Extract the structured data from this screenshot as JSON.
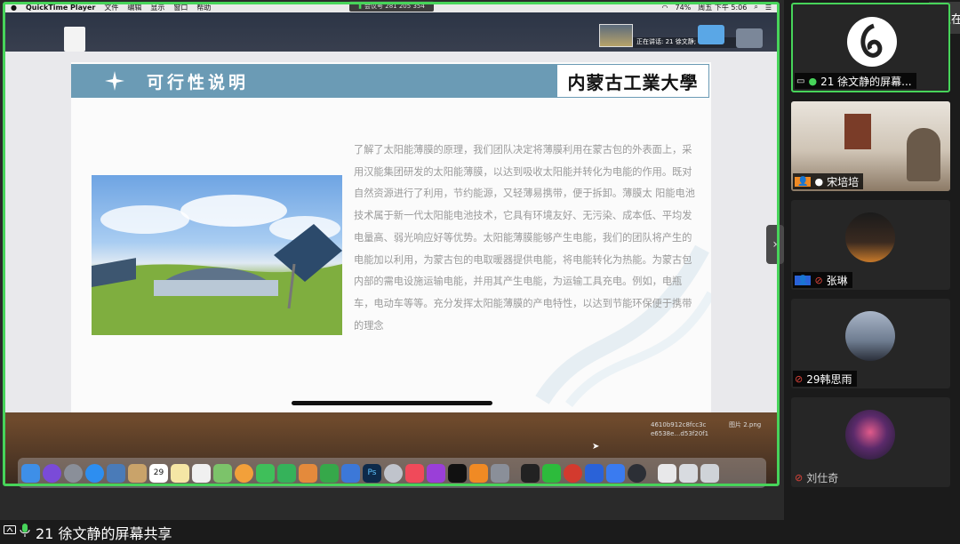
{
  "menubar": {
    "app_name": "QuickTime Player",
    "items": [
      "文件",
      "编辑",
      "显示",
      "窗口",
      "帮助"
    ],
    "meeting_id": "会议号 281 205 354",
    "battery": "74%",
    "clock": "周五 下午 5:06"
  },
  "desktop": {
    "speaking_label": "正在讲话: 21 徐文静;",
    "hash_line1": "4610b912c8fcc3c",
    "hash_line2": "e6538e…d53f20f1",
    "png_name": "图片 2.png",
    "calendar_day": "29"
  },
  "slide": {
    "title": "可行性说明",
    "logo_text": "内蒙古工業大學",
    "paragraph": "了解了太阳能薄膜的原理，我们团队决定将薄膜利用在蒙古包的外表面上，采用汉能集团研发的太阳能薄膜，以达到吸收太阳能并转化为电能的作用。既对自然资源进行了利用，节约能源，又轻薄易携带，便于拆卸。薄膜太 阳能电池技术属于新一代太阳能电池技术，它具有环境友好、无污染、成本低、平均发电量高、弱光响应好等优势。太阳能薄膜能够产生电能，我们的团队将产生的电能加以利用，为蒙古包的电取暖器提供电能，将电能转化为热能。为蒙古包内部的需电设施运输电能，并用其产生电能，为运输工具充电。例如，电瓶车，电动车等等。充分发挥太阳能薄膜的产电特性，以达到节能环保便于携带的理念",
    "next_arrow": "›"
  },
  "share_bar": {
    "label": "21 徐文静的屏幕共享"
  },
  "corner": {
    "label": "正在"
  },
  "participants": [
    {
      "name": "21 徐文静的屏幕...",
      "status": "speaking"
    },
    {
      "name": "宋培培",
      "status": "unmuted"
    },
    {
      "name": "张琳",
      "status": "muted"
    },
    {
      "name": "29韩思雨",
      "status": "muted"
    },
    {
      "name": "刘仕奇",
      "status": "muted"
    }
  ],
  "colors": {
    "active_border": "#47d45a",
    "slide_header": "#6b9bb5",
    "mute_red": "#e0443a"
  }
}
